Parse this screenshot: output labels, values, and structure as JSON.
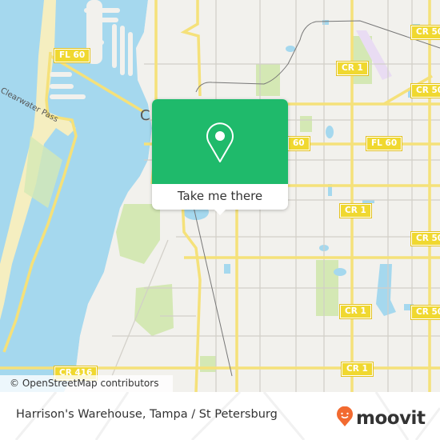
{
  "map": {
    "road_labels": [
      {
        "id": "fl60-west",
        "text": "FL 60"
      },
      {
        "id": "fl60-east",
        "text": "FL 60"
      },
      {
        "id": "fl60-mid",
        "text": "60"
      },
      {
        "id": "cr1-north",
        "text": "CR 1"
      },
      {
        "id": "cr1-mid",
        "text": "CR 1"
      },
      {
        "id": "cr1-south1",
        "text": "CR 1"
      },
      {
        "id": "cr1-south2",
        "text": "CR 1"
      },
      {
        "id": "cr50x-top",
        "text": "CR 50"
      },
      {
        "id": "cr50x-2",
        "text": "CR 50"
      },
      {
        "id": "cr50x-3",
        "text": "CR 50"
      },
      {
        "id": "cr50x-4",
        "text": "CR 50"
      },
      {
        "id": "cr416",
        "text": "CR 416"
      }
    ],
    "place_labels": {
      "pass": "Clearwater Pass",
      "city_initial": "C"
    },
    "colors": {
      "water": "#a5d8ee",
      "land": "#f2f1ed",
      "park": "#d4e8b4",
      "road_major": "#f5e17a",
      "road_minor": "#d2cfc8",
      "rail": "#777777",
      "sand": "#f5eec0"
    }
  },
  "attribution": "© OpenStreetMap contributors",
  "popup": {
    "icon": "map-pin-icon",
    "button_label": "Take me there",
    "color": "#1fba6b"
  },
  "footer": {
    "title": "Harrison's Warehouse, Tampa / St Petersburg",
    "logo_text": "moovit",
    "logo_color": "#f26a30"
  }
}
